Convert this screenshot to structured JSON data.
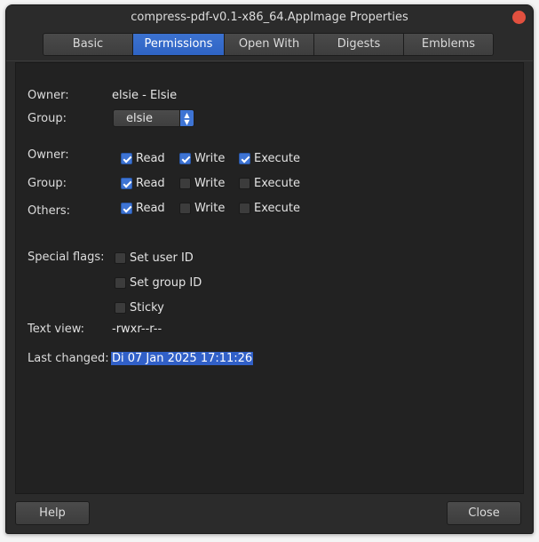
{
  "window": {
    "title": "compress-pdf-v0.1-x86_64.AppImage Properties",
    "close_color": "#e2503f"
  },
  "tabs": [
    {
      "label": "Basic",
      "active": false
    },
    {
      "label": "Permissions",
      "active": true
    },
    {
      "label": "Open With",
      "active": false
    },
    {
      "label": "Digests",
      "active": false
    },
    {
      "label": "Emblems",
      "active": false
    }
  ],
  "ownership": {
    "owner_label": "Owner:",
    "owner_value": "elsie - Elsie",
    "group_label": "Group:",
    "group_value": "elsie"
  },
  "permissions": {
    "rows": [
      {
        "label": "Owner:",
        "read": true,
        "write": true,
        "execute": true
      },
      {
        "label": "Group:",
        "read": true,
        "write": false,
        "execute": false
      },
      {
        "label": "Others:",
        "read": true,
        "write": false,
        "execute": false
      }
    ],
    "read_label": "Read",
    "write_label": "Write",
    "execute_label": "Execute"
  },
  "special_flags": {
    "label": "Special flags:",
    "set_user_id": {
      "label": "Set user ID",
      "checked": false
    },
    "set_group_id": {
      "label": "Set group ID",
      "checked": false
    },
    "sticky": {
      "label": "Sticky",
      "checked": false
    }
  },
  "text_view": {
    "label": "Text view:",
    "value": "-rwxr--r--"
  },
  "last_changed": {
    "label": "Last changed:",
    "value": "Di 07 Jan 2025 17:11:26"
  },
  "footer": {
    "help_label": "Help",
    "close_label": "Close"
  },
  "colors": {
    "accent": "#3e74d4",
    "background": "#2b2b2b",
    "panel": "#222222"
  }
}
